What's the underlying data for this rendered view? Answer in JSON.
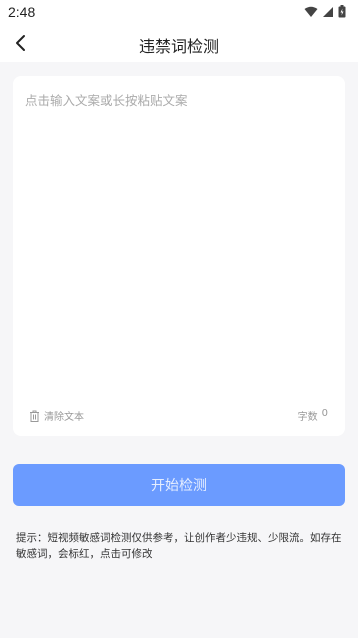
{
  "status_bar": {
    "time": "2:48",
    "icons": [
      "wifi-icon",
      "signal-icon",
      "battery-icon"
    ]
  },
  "app_bar": {
    "title": "违禁词检测",
    "back_icon": "back-arrow-icon"
  },
  "editor": {
    "placeholder": "点击输入文案或长按粘贴文案",
    "value": "",
    "clear_label": "清除文本",
    "count_label": "字数",
    "count_value": "0"
  },
  "action": {
    "start_label": "开始检测"
  },
  "tip": {
    "text": "提示：短视频敏感词检测仅供参考，让创作者少违规、少限流。如存在敏感词，会标红，点击可修改"
  },
  "colors": {
    "accent": "#6b9bff",
    "background": "#f6f6f8",
    "card": "#ffffff"
  }
}
